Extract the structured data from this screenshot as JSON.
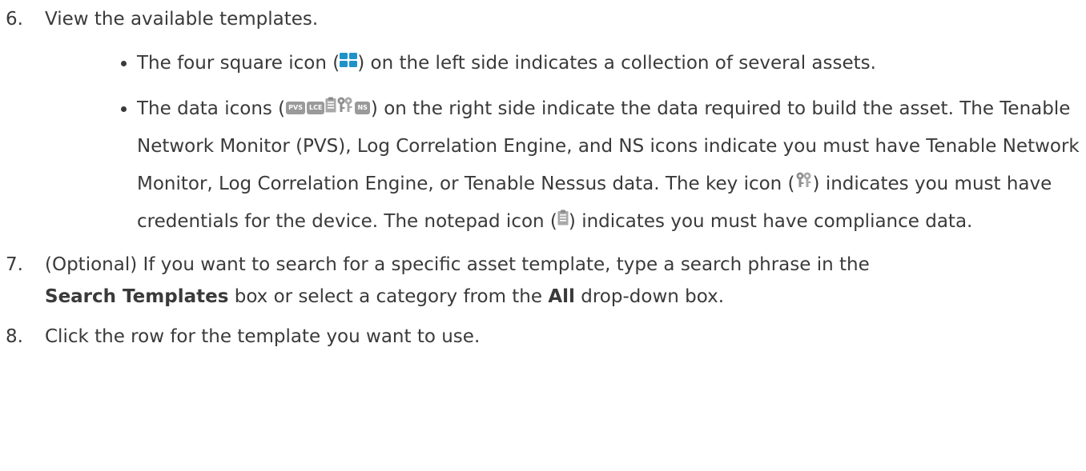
{
  "steps": [
    {
      "number": "6.",
      "text": "View the available templates.",
      "bullets": [
        {
          "before_icon": "The four square icon (",
          "icon": "four-square-icon",
          "after_icon": ") on the left side indicates a collection of several assets."
        },
        {
          "before_icons": "The data icons (",
          "icons": [
            {
              "name": "pvs-icon",
              "label": "PVS"
            },
            {
              "name": "lce-icon",
              "label": "LCE"
            },
            {
              "name": "notepad-icon"
            },
            {
              "name": "key-icon"
            },
            {
              "name": "ns-icon",
              "label": "NS"
            }
          ],
          "after_icons": ") on the right side indicate the data required to build the asset. The Tenable Network Monitor (PVS), Log Correlation Engine, and NS icons indicate you must have Tenable Network Monitor, Log Correlation Engine, or Tenable Nessus data. The key icon (",
          "after_key": ") indicates you must have credentials for the device. The notepad icon (",
          "after_notepad": ") indicates you must have compliance data."
        }
      ]
    },
    {
      "number": "7.",
      "text_1": "(Optional) If you want to search for a specific asset template, type a search phrase in the",
      "bold_1": "Search Templates",
      "text_2": " box or select a category from the ",
      "bold_2": "All",
      "text_3": " drop-down box."
    },
    {
      "number": "8.",
      "text": "Click the row for the template you want to use."
    }
  ],
  "colors": {
    "text": "#3a3a3a",
    "four_square_icon": "#1f93c9",
    "badge": "#9a9a9a"
  }
}
